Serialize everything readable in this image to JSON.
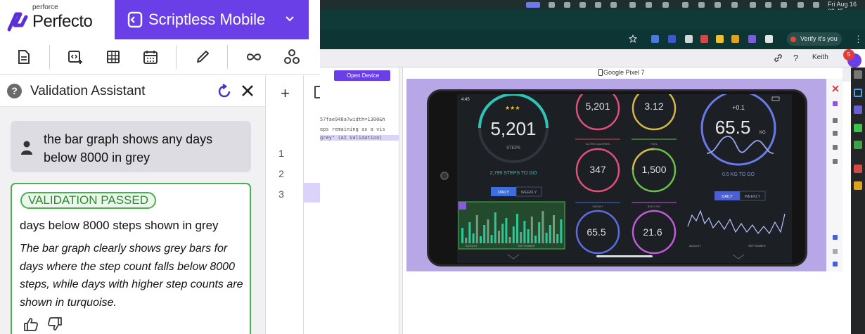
{
  "brand": {
    "company": "perforce",
    "product": "Perfecto"
  },
  "product_switcher": {
    "label": "Scriptless Mobile"
  },
  "toolbar": {
    "items": [
      "document-icon",
      "add-code-icon",
      "table-icon",
      "calendar-icon",
      "pencil-icon",
      "loop-icon",
      "network-icon"
    ]
  },
  "validation_assistant": {
    "title": "Validation Assistant",
    "user_message": "the bar graph shows any days below 8000 in grey",
    "result": {
      "badge": "VALIDATION PASSED",
      "title": "days below 8000 steps shown in grey",
      "description": "The bar graph clearly shows grey bars for days where the step count falls below 8000 steps, while days with higher step counts are shown in turquoise."
    }
  },
  "side_column": {
    "add": "+",
    "lines": [
      "1",
      "2",
      "3"
    ]
  },
  "browser": {
    "clock": "Fri Aug 16 09:45",
    "verify_label": "Verify it's you",
    "user_name": "Keith",
    "notification_count": "5",
    "open_device_label": "Open Device",
    "device_name": "Google Pixel 7",
    "code_lines": [
      "57fae948a?width=1300&h",
      "eps remaining as a vis",
      "grey\" (AI Validation)"
    ]
  },
  "fitness_app": {
    "status_time": "4:45",
    "steps": "5,201",
    "steps_label": "STEPS",
    "steps_to_go": "2,799 STEPS TO GO",
    "stars": "★★★",
    "active_calories": "347",
    "active_calories_label": "ACTIVE CALORIES",
    "fuel": "1,500",
    "fuel_label": "FUEL",
    "small_top_left": "5,201",
    "small_top_right": "3.12",
    "weight": "65.5",
    "weight_unit": "KG",
    "weight_delta": "+0.1",
    "kg_to_go": "0.5 KG TO GO",
    "small_weight": "65.5",
    "small_body_fat": "21.6",
    "weight_label": "WEIGHT",
    "body_fat_label": "BODY FAT",
    "tab_daily": "DAILY",
    "tab_weekly": "WEEKLY",
    "x_labels": [
      "AUGUST",
      "SEPTEMBER"
    ]
  },
  "colors": {
    "brand_purple": "#6b3fe8",
    "pass_green": "#4caf50",
    "steps_bar_turquoise": "#2ec4b6",
    "steps_bar_grey": "#8a8f95"
  }
}
